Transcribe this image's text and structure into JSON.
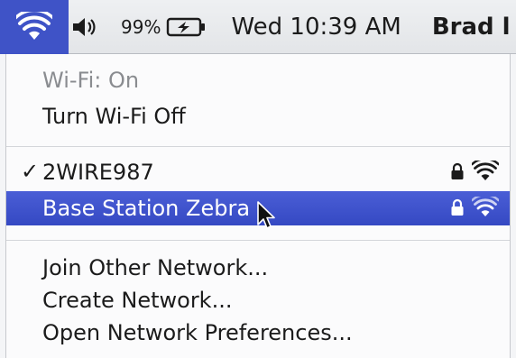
{
  "menubar": {
    "battery_percent": "99%",
    "clock": "Wed 10:39 AM",
    "user": "Brad l"
  },
  "wifi_menu": {
    "status": "Wi-Fi: On",
    "toggle_label": "Turn Wi-Fi Off",
    "networks": [
      {
        "name": "2WIRE987",
        "connected": true,
        "locked": true,
        "icon": "wifi-signal-icon"
      },
      {
        "name": "Base Station Zebra",
        "connected": false,
        "locked": true,
        "highlighted": true,
        "icon": "wifi-signal-icon"
      }
    ],
    "check_mark": "✓",
    "join_other": "Join Other Network...",
    "create_network": "Create Network...",
    "open_prefs": "Open Network Preferences..."
  },
  "colors": {
    "highlight": "#3f53c7",
    "menubar": "#e7e9ec",
    "menu_bg": "#fbfbfc"
  }
}
